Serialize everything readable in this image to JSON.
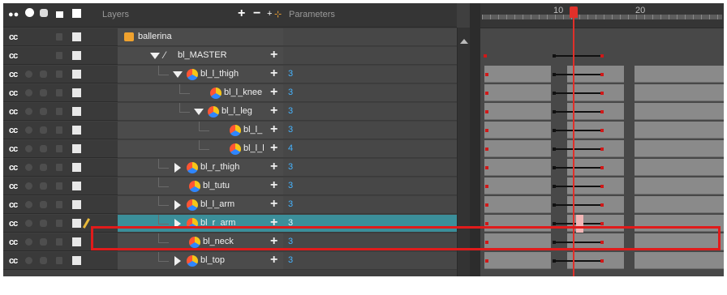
{
  "header": {
    "layers_label": "Layers",
    "parameters_label": "Parameters",
    "frame_numbers": [
      "10",
      "20"
    ],
    "icons": [
      "eye-icon",
      "lock-icon",
      "color-swatch-icon",
      "add-layer-icon",
      "remove-layer-icon",
      "add-peg-icon",
      "add-deformation-icon"
    ]
  },
  "layers": [
    {
      "name": "ballerina",
      "param": "",
      "depth": 0,
      "expander": "none",
      "node": "group-icon",
      "selected": false,
      "locked_white": true
    },
    {
      "name": "bl_MASTER",
      "param": "",
      "depth": 1,
      "expander": "down",
      "node": "peg-icon",
      "selected": false,
      "locked_white": true
    },
    {
      "name": "bl_l_thigh",
      "param": "3",
      "depth": 2,
      "expander": "down",
      "node": "drawing-icon",
      "selected": false
    },
    {
      "name": "bl_l_knee",
      "param": "3",
      "depth": 3,
      "expander": "none",
      "node": "drawing-icon",
      "selected": false
    },
    {
      "name": "bl_l_leg",
      "param": "3",
      "depth": 3,
      "expander": "down",
      "node": "drawing-icon",
      "selected": false
    },
    {
      "name": "bl_l_",
      "param": "3",
      "depth": 4,
      "expander": "none",
      "node": "drawing-icon",
      "selected": false
    },
    {
      "name": "bl_l_l",
      "param": "4",
      "depth": 4,
      "expander": "none",
      "node": "drawing-icon",
      "selected": false
    },
    {
      "name": "bl_r_thigh",
      "param": "3",
      "depth": 2,
      "expander": "right",
      "node": "drawing-icon",
      "selected": false
    },
    {
      "name": "bl_tutu",
      "param": "3",
      "depth": 2,
      "expander": "none",
      "node": "drawing-icon",
      "selected": false
    },
    {
      "name": "bl_l_arm",
      "param": "3",
      "depth": 2,
      "expander": "right",
      "node": "drawing-icon",
      "selected": false
    },
    {
      "name": "bl_r_arm",
      "param": "3",
      "depth": 2,
      "expander": "right",
      "node": "drawing-icon",
      "selected": true
    },
    {
      "name": "bl_neck",
      "param": "3",
      "depth": 2,
      "expander": "none",
      "node": "drawing-icon",
      "selected": false
    },
    {
      "name": "bl_top",
      "param": "3",
      "depth": 2,
      "expander": "right",
      "node": "drawing-icon",
      "selected": false
    }
  ],
  "colors": {
    "selection": "#3b8f9a",
    "highlight_box": "#e01b1b",
    "playhead": "#e0302a",
    "param_value": "#46b4ff"
  }
}
